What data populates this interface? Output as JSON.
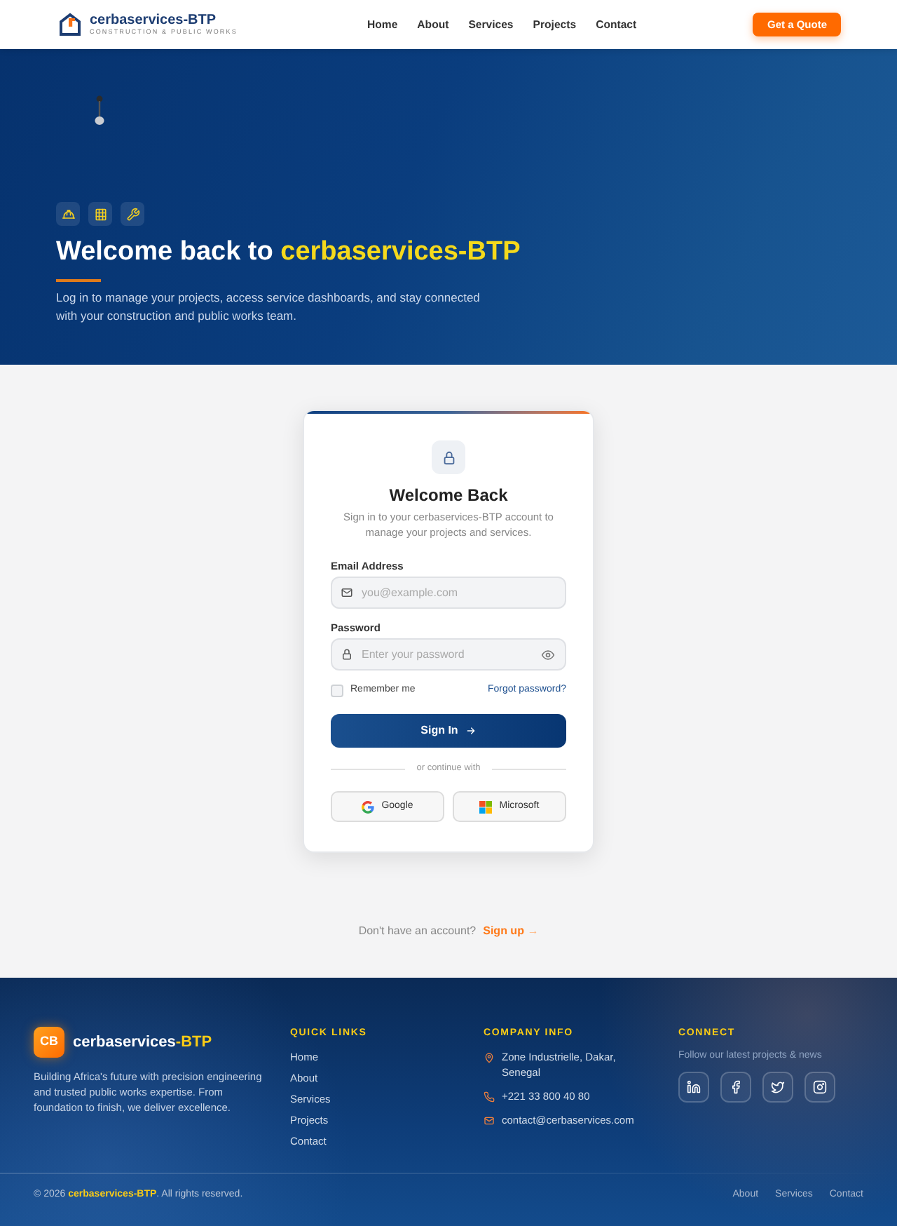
{
  "header": {
    "brand": {
      "name": "cerbaservices-BTP",
      "tagline": "CONSTRUCTION & PUBLIC WORKS"
    },
    "nav": [
      "Home",
      "About",
      "Services",
      "Projects",
      "Contact"
    ],
    "cta": "Get a Quote"
  },
  "hero": {
    "badges": [
      {
        "kind": "hard-hat"
      },
      {
        "kind": "building"
      },
      {
        "kind": "wrench"
      }
    ],
    "title": {
      "text": "Welcome back to",
      "highlight": "cerbaservices-BTP"
    },
    "subtitle": "Log in to manage your projects, access service dashboards, and stay connected with your construction and public works team."
  },
  "login_card": {
    "title": "Welcome Back",
    "subtitle": "Sign in to your cerbaservices-BTP account to manage your projects and services.",
    "fields": [
      {
        "kind": "email",
        "label": "Email Address",
        "placeholder": "you@example.com"
      },
      {
        "kind": "password",
        "label": "Password",
        "placeholder": "Enter your password"
      }
    ],
    "remember": {
      "label": "Remember me",
      "checked": false
    },
    "forgot": "Forgot password?",
    "submit": "Sign In",
    "divider": "or continue with",
    "social": [
      {
        "kind": "google",
        "label": "Google"
      },
      {
        "kind": "microsoft",
        "label": "Microsoft"
      }
    ]
  },
  "signup": {
    "text": "Don't have an account?",
    "link": "Sign up",
    "arrow": "→"
  },
  "footer": {
    "brand": {
      "logo": "CB",
      "name": "cerbaservices",
      "suffix": "-BTP"
    },
    "description": "Building Africa's future with precision engineering and trusted public works expertise. From foundation to finish, we deliver excellence.",
    "quick_links": {
      "heading": "QUICK LINKS",
      "links": [
        "Home",
        "About",
        "Services",
        "Projects",
        "Contact"
      ]
    },
    "company_info": {
      "heading": "COMPANY INFO",
      "items": [
        {
          "kind": "address",
          "text": "Zone Industrielle, Dakar, Senegal"
        },
        {
          "kind": "phone",
          "text": "+221 33 800 40 80"
        },
        {
          "kind": "email",
          "text": "contact@cerbaservices.com"
        }
      ]
    },
    "connect": {
      "heading": "CONNECT",
      "text": "Follow our latest projects & news",
      "social": [
        {
          "kind": "linkedin"
        },
        {
          "kind": "facebook"
        },
        {
          "kind": "twitter"
        },
        {
          "kind": "instagram"
        }
      ]
    },
    "copyright": "© 2026 **cerbaservices-BTP**. All rights reserved.",
    "bottom_links": [
      "About",
      "Services",
      "Contact"
    ]
  }
}
